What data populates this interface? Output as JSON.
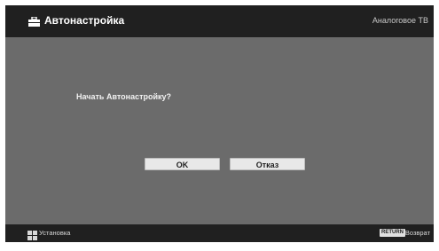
{
  "header": {
    "title": "Автонастройка",
    "source": "Аналоговое ТВ",
    "icon": "toolbox-icon"
  },
  "dialog": {
    "question": "Начать Автонастройку?",
    "ok_label": "OK",
    "cancel_label": "Отказ"
  },
  "footer": {
    "setup_icon": "setup-grid-icon",
    "setup_label": "Установка",
    "return_badge": "RETURN",
    "back_label": "Возврат"
  },
  "colors": {
    "background": "#6b6b6b",
    "bars": "#202020",
    "button": "#e8e8e8"
  }
}
